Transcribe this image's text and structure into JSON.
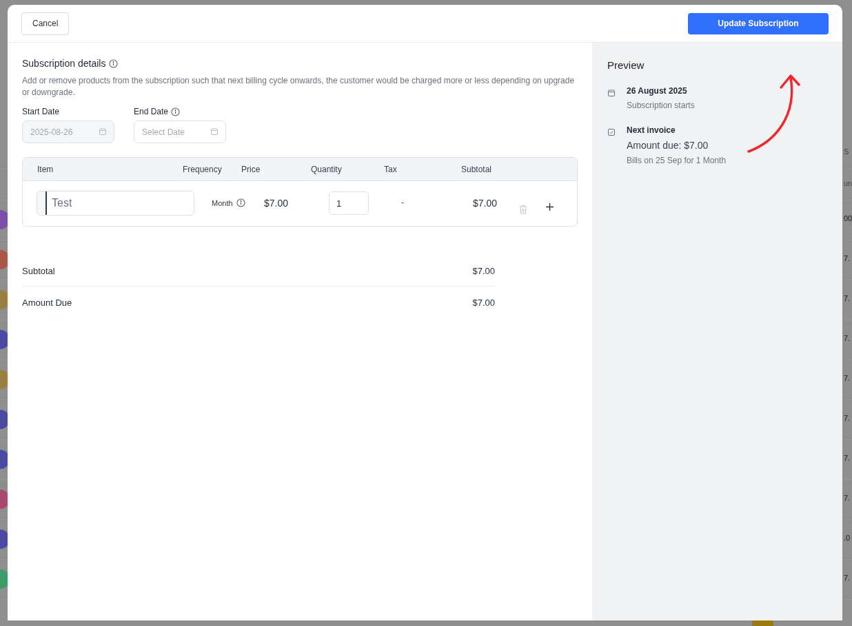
{
  "backdrop": {
    "header_fragments": [
      "S",
      "un"
    ],
    "rows": [
      {
        "color": "#7b4fa8",
        "amount": "00"
      },
      {
        "color": "#a8574a",
        "amount": "7."
      },
      {
        "color": "#9a8040",
        "amount": "7."
      },
      {
        "color": "#4a4aa0",
        "amount": "7."
      },
      {
        "color": "#9a8040",
        "amount": "7."
      },
      {
        "color": "#4a4aa0",
        "amount": "7."
      },
      {
        "color": "#4a4aa0",
        "amount": "7."
      },
      {
        "color": "#a84a70",
        "amount": "7."
      },
      {
        "color": "#4a4aa0",
        "amount": ".0"
      },
      {
        "color": "#3f9a6a",
        "amount": "7."
      }
    ]
  },
  "header": {
    "cancel": "Cancel",
    "submit": "Update Subscription"
  },
  "details": {
    "title": "Subscription details",
    "description": "Add or remove products from the subscription such that next billing cycle onwards, the customer would be charged more or less depending on upgrade or downgrade.",
    "start_date": {
      "label": "Start Date",
      "value": "2025-08-26",
      "disabled": true
    },
    "end_date": {
      "label": "End Date",
      "placeholder": "Select Date"
    }
  },
  "items_table": {
    "columns": [
      "Item",
      "Frequency",
      "Price",
      "Quantity",
      "Tax",
      "Subtotal"
    ],
    "rows": [
      {
        "item": "Test",
        "frequency": "Month",
        "price": "$7.00",
        "quantity": "1",
        "tax": "-",
        "subtotal": "$7.00"
      }
    ]
  },
  "totals": [
    {
      "label": "Subtotal",
      "value": "$7.00"
    },
    {
      "label": "Amount Due",
      "value": "$7.00"
    }
  ],
  "preview": {
    "title": "Preview",
    "events": [
      {
        "kind": "start",
        "title": "26 August 2025",
        "subtitle": "Subscription starts"
      },
      {
        "kind": "invoice",
        "title": "Next invoice",
        "amount": "Amount due: $7.00",
        "subtitle": "Bills on 25 Sep for 1 Month"
      }
    ]
  }
}
